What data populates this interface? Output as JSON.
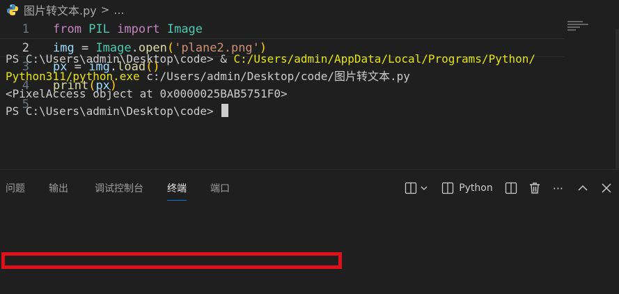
{
  "breadcrumb": {
    "file": "图片转文本.py",
    "separator": ">",
    "ellipsis": "..."
  },
  "editor": {
    "current_line": 2,
    "lines": [
      {
        "num": "1",
        "tokens": [
          [
            "kw",
            "from"
          ],
          [
            "op",
            " "
          ],
          [
            "mod",
            "PIL"
          ],
          [
            "op",
            " "
          ],
          [
            "kw",
            "import"
          ],
          [
            "op",
            " "
          ],
          [
            "mod",
            "Image"
          ]
        ]
      },
      {
        "num": "2",
        "tokens": [
          [
            "var",
            "img"
          ],
          [
            "op",
            " = "
          ],
          [
            "mod",
            "Image"
          ],
          [
            "op",
            "."
          ],
          [
            "fn",
            "open"
          ],
          [
            "br1",
            "("
          ],
          [
            "str",
            "'plane2.png'"
          ],
          [
            "br1",
            ")"
          ]
        ]
      },
      {
        "num": "3",
        "tokens": [
          [
            "var",
            "px"
          ],
          [
            "op",
            " = "
          ],
          [
            "var",
            "img"
          ],
          [
            "op",
            "."
          ],
          [
            "fn",
            "load"
          ],
          [
            "br1",
            "()"
          ]
        ]
      },
      {
        "num": "4",
        "tokens": [
          [
            "fn",
            "print"
          ],
          [
            "br1",
            "("
          ],
          [
            "var",
            "px"
          ],
          [
            "br1",
            ")"
          ]
        ]
      },
      {
        "num": "5",
        "tokens": []
      }
    ]
  },
  "panel": {
    "tabs": [
      {
        "label": "问题",
        "active": false
      },
      {
        "label": "输出",
        "active": false
      },
      {
        "label": "调试控制台",
        "active": false
      },
      {
        "label": "终端",
        "active": true
      },
      {
        "label": "端口",
        "active": false
      }
    ],
    "toolbar": {
      "terminal_name": "Python",
      "more": "···"
    }
  },
  "terminal": {
    "line1_prompt": "PS C:\\Users\\admin\\Desktop\\code> & ",
    "line1_cmd": "C:/Users/admin/AppData/Local/Programs/Python/",
    "line2_cmd": "Python311/python.exe",
    "line2_arg": " c:/Users/admin/Desktop/code/图片转文本.py",
    "line3_output": "<PixelAccess object at 0x0000025BAB5751F0>",
    "line4_prompt": "PS C:\\Users\\admin\\Desktop\\code> "
  },
  "colors": {
    "highlight_box": "#e0101a",
    "active_tab_underline": "#0078d4",
    "command_yellow": "#e5e510"
  }
}
